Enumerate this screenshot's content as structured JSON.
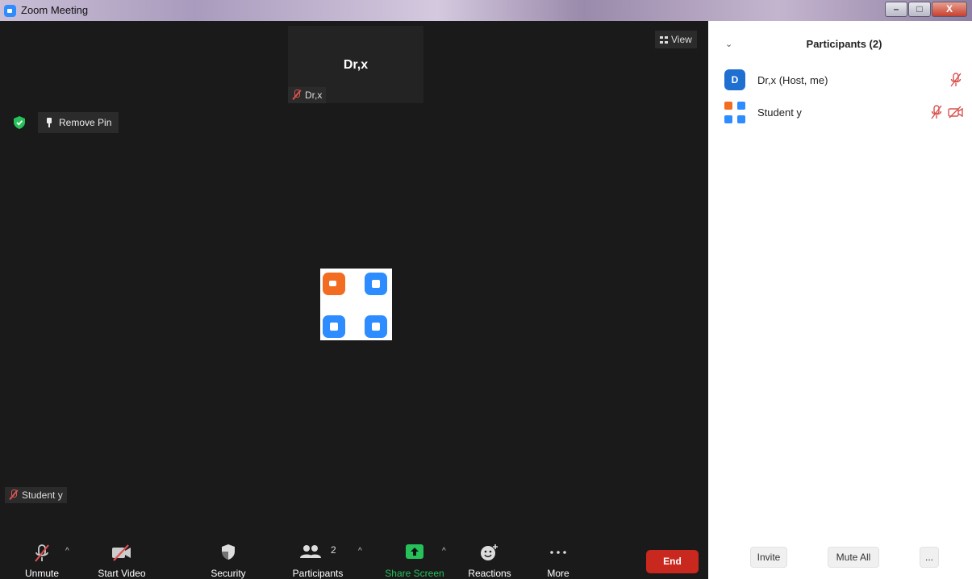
{
  "window": {
    "title": "Zoom Meeting",
    "controls": {
      "minimize": "–",
      "maximize": "□",
      "close": "X"
    }
  },
  "meeting": {
    "top_thumbnail": {
      "display_name": "Dr,x",
      "label": "Dr,x",
      "muted": true
    },
    "view_button": "View",
    "remove_pin_button": "Remove Pin",
    "pinned_participant_label": "Student y",
    "colors": {
      "background": "#1a1a1a",
      "tag": "#2b2b2b",
      "muted": "#d9534f",
      "security": "#26c15b"
    }
  },
  "toolbar": {
    "unmute": "Unmute",
    "start_video": "Start Video",
    "security": "Security",
    "participants": "Participants",
    "participants_count": "2",
    "share_screen": "Share Screen",
    "reactions": "Reactions",
    "more": "More",
    "end": "End",
    "colors": {
      "share": "#26c15b",
      "end": "#c8281e"
    }
  },
  "participants_panel": {
    "title": "Participants (2)",
    "participants": [
      {
        "name": "Dr,x (Host, me)",
        "avatar_letter": "D",
        "audio_muted": true,
        "video_off": false
      },
      {
        "name": "Student y",
        "audio_muted": true,
        "video_off": true
      }
    ],
    "buttons": {
      "invite": "Invite",
      "mute_all": "Mute All",
      "more": "..."
    }
  }
}
